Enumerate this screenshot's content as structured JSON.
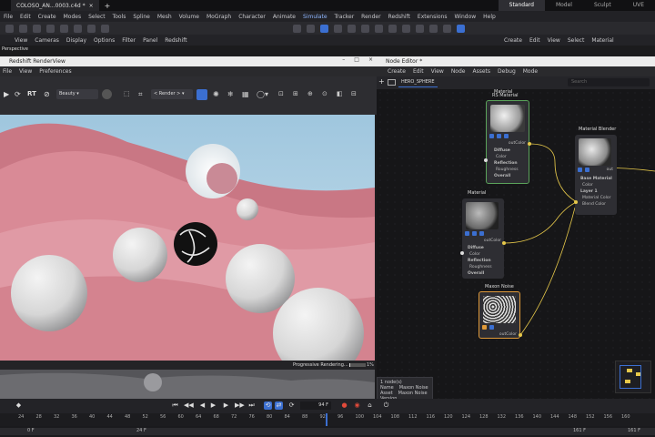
{
  "window": {
    "file_tab": "COLOSO_AN...0003.c4d *",
    "layout_tabs": [
      "Standard",
      "Model",
      "Sculpt",
      "UVE"
    ],
    "active_layout": "Standard"
  },
  "menubar": [
    "File",
    "Edit",
    "Create",
    "Modes",
    "Select",
    "Tools",
    "Spline",
    "Mesh",
    "Volume",
    "MoGraph",
    "Character",
    "Animate",
    "Simulate",
    "Tracker",
    "Render",
    "Redshift",
    "Extensions",
    "Window",
    "Help"
  ],
  "viewport": {
    "menu": [
      "View",
      "Cameras",
      "Display",
      "Options",
      "Filter",
      "Panel",
      "Redshift"
    ],
    "label": "Perspective"
  },
  "attr_menu": [
    "Create",
    "Edit",
    "View",
    "Select",
    "Material"
  ],
  "renderview": {
    "title": "Redshift RenderView",
    "menu": [
      "File",
      "View",
      "Preferences"
    ],
    "aov": "Beauty",
    "rt_label": "RT",
    "render_dropdown": "< Render >",
    "status_text": "Progressive Rendering...",
    "progress_pct": "1%",
    "progress": 0.01
  },
  "node_editor": {
    "title": "Node Editor *",
    "menu": [
      "Create",
      "Edit",
      "View",
      "Node",
      "Assets",
      "Debug",
      "Mode"
    ],
    "breadcrumb": "HERO_SPHERE",
    "search_placeholder": "Search",
    "nodes": {
      "rs_material": {
        "header_small": "Material",
        "header": "RS Material",
        "out": "outColor",
        "ports": [
          "Diffuse",
          "Color",
          "Reflection",
          "Roughness",
          "Overall"
        ]
      },
      "material_blender": {
        "header": "Material Blender",
        "out": "out",
        "ports": [
          "Base Material",
          "Color",
          "Layer 1",
          "Material Color",
          "Blend Color"
        ]
      },
      "material": {
        "header": "Material",
        "out": "outColor",
        "ports": [
          "Diffuse",
          "Color",
          "Reflection",
          "Roughness",
          "Overall"
        ]
      },
      "maxon_noise": {
        "header": "Maxon Noise",
        "out": "outColor"
      }
    },
    "info": {
      "count": "1 node(s)",
      "name_label": "Name",
      "name_value": "Maxon Noise",
      "asset_label": "Asset",
      "asset_value": "Maxon Noise",
      "version_label": "Version"
    }
  },
  "timeline": {
    "current_frame": "94 F",
    "ruler_ticks": [
      "24",
      "28",
      "32",
      "36",
      "40",
      "44",
      "48",
      "52",
      "56",
      "60",
      "64",
      "68",
      "72",
      "76",
      "80",
      "84",
      "88",
      "92",
      "96",
      "100",
      "104",
      "108",
      "112",
      "116",
      "120",
      "124",
      "128",
      "132",
      "136",
      "140",
      "144",
      "148",
      "152",
      "156",
      "160"
    ],
    "range_start": "0 F",
    "range_mid": "24 F",
    "range_end": "161 F",
    "range_end2": "161 F"
  },
  "colors": {
    "accent": "#3b6fd1",
    "wire": "#e6c84a",
    "render_pink": "#d98a96",
    "sky": "#9fc6de"
  }
}
